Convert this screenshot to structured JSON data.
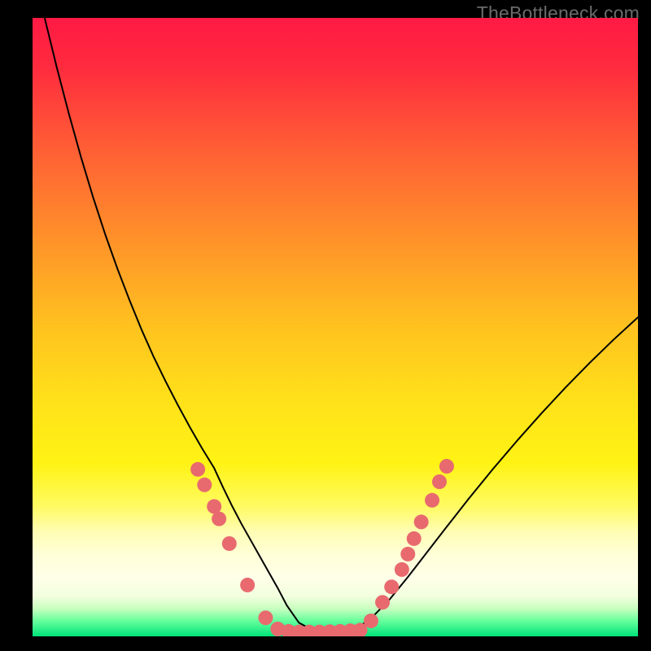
{
  "watermark": "TheBottleneck.com",
  "chart_data": {
    "type": "line",
    "title": "",
    "xlabel": "",
    "ylabel": "",
    "xlim": [
      0,
      100
    ],
    "ylim": [
      0,
      100
    ],
    "background_gradient": {
      "stops": [
        {
          "offset": 0.0,
          "color": "#ff1a44"
        },
        {
          "offset": 0.08,
          "color": "#ff2b3e"
        },
        {
          "offset": 0.2,
          "color": "#ff5a36"
        },
        {
          "offset": 0.35,
          "color": "#ff8f2a"
        },
        {
          "offset": 0.5,
          "color": "#ffc21f"
        },
        {
          "offset": 0.62,
          "color": "#ffe11a"
        },
        {
          "offset": 0.72,
          "color": "#fff314"
        },
        {
          "offset": 0.79,
          "color": "#fffb62"
        },
        {
          "offset": 0.83,
          "color": "#fffdb3"
        },
        {
          "offset": 0.87,
          "color": "#ffffd9"
        },
        {
          "offset": 0.905,
          "color": "#ffffe8"
        },
        {
          "offset": 0.935,
          "color": "#f2ffdf"
        },
        {
          "offset": 0.955,
          "color": "#c9ffbf"
        },
        {
          "offset": 0.975,
          "color": "#66ff9c"
        },
        {
          "offset": 1.0,
          "color": "#00e37a"
        }
      ]
    },
    "series": [
      {
        "name": "bottleneck-curve",
        "color": "#000000",
        "stroke_width": 2,
        "x": [
          2,
          4,
          6,
          8,
          10,
          12,
          14,
          16,
          18,
          20,
          22,
          24,
          26,
          28,
          30,
          31.5,
          33,
          34.5,
          36,
          37.5,
          39,
          40.5,
          42,
          44,
          47,
          50,
          53,
          56,
          59,
          62,
          65,
          68,
          72,
          76,
          80,
          84,
          88,
          92,
          96,
          100
        ],
        "y": [
          100,
          92,
          84.5,
          77.5,
          71,
          65,
          59.5,
          54.4,
          49.6,
          45.2,
          41.2,
          37.4,
          33.8,
          30.4,
          27.2,
          24.0,
          21.0,
          18.2,
          15.6,
          13.0,
          10.4,
          7.8,
          5.0,
          2.2,
          0.6,
          0.3,
          0.9,
          3.0,
          6.0,
          9.6,
          13.4,
          17.2,
          22.2,
          27.0,
          31.6,
          36.0,
          40.2,
          44.2,
          48.0,
          51.6
        ]
      }
    ],
    "markers": {
      "name": "highlight-dots",
      "color": "#e86a6f",
      "radius_px": 9,
      "points": [
        {
          "x": 27.3,
          "y": 27.0
        },
        {
          "x": 28.4,
          "y": 24.5
        },
        {
          "x": 30.0,
          "y": 21.0
        },
        {
          "x": 30.8,
          "y": 19.0
        },
        {
          "x": 32.5,
          "y": 15.0
        },
        {
          "x": 35.5,
          "y": 8.3
        },
        {
          "x": 38.5,
          "y": 3.0
        },
        {
          "x": 40.5,
          "y": 1.2
        },
        {
          "x": 42.3,
          "y": 0.8
        },
        {
          "x": 44.0,
          "y": 0.7
        },
        {
          "x": 45.7,
          "y": 0.7
        },
        {
          "x": 47.4,
          "y": 0.7
        },
        {
          "x": 49.1,
          "y": 0.75
        },
        {
          "x": 50.8,
          "y": 0.8
        },
        {
          "x": 52.5,
          "y": 0.9
        },
        {
          "x": 54.1,
          "y": 1.0
        },
        {
          "x": 55.9,
          "y": 2.5
        },
        {
          "x": 57.8,
          "y": 5.5
        },
        {
          "x": 59.3,
          "y": 8.0
        },
        {
          "x": 61.0,
          "y": 10.8
        },
        {
          "x": 62.0,
          "y": 13.3
        },
        {
          "x": 63.0,
          "y": 15.8
        },
        {
          "x": 64.2,
          "y": 18.5
        },
        {
          "x": 66.0,
          "y": 22.0
        },
        {
          "x": 67.2,
          "y": 25.0
        },
        {
          "x": 68.4,
          "y": 27.5
        }
      ]
    }
  }
}
